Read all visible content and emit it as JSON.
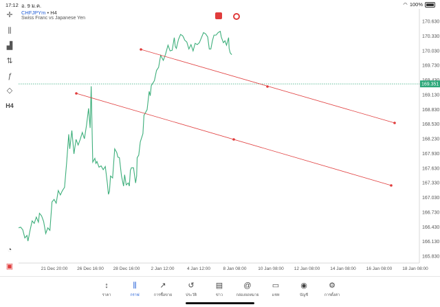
{
  "status": {
    "time": "17:12",
    "date": "อ. 9 ม.ค.",
    "battery": "100%"
  },
  "symbol": {
    "name": "CHFJPYm",
    "sep": "•",
    "timeframe": "H4",
    "description": "Swiss Franc vs Japanese Yen"
  },
  "left_tools": {
    "timeframe_label": "H4"
  },
  "chart": {
    "price_labels": [
      "170.630",
      "170.330",
      "170.030",
      "169.730",
      "169.430",
      "169.130",
      "168.830",
      "168.530",
      "168.230",
      "167.930",
      "167.630",
      "167.330",
      "167.030",
      "166.730",
      "166.430",
      "166.130",
      "165.830"
    ],
    "current_price": "169.351",
    "time_labels": [
      "21 Dec 20:00",
      "26 Dec 16:00",
      "28 Dec 16:00",
      "2 Jan 12:00",
      "4 Jan 12:00",
      "8 Jan 08:00",
      "10 Jan 08:00",
      "12 Jan 08:00",
      "14 Jan 08:00",
      "16 Jan 08:00",
      "18 Jan 08:00"
    ]
  },
  "colors": {
    "line": "#3cae7a",
    "trend": "#e03c3c",
    "price_line": "#2ea87a",
    "accent": "#1e5bd6"
  },
  "tabs": [
    {
      "label": "ราคา",
      "icon": "↕"
    },
    {
      "label": "กราฟ",
      "icon": "⫼"
    },
    {
      "label": "การซื้อขาย",
      "icon": "↗"
    },
    {
      "label": "ประวัติ",
      "icon": "↺"
    },
    {
      "label": "ข่าว",
      "icon": "▤"
    },
    {
      "label": "กล่องจดหมาย",
      "icon": "@"
    },
    {
      "label": "แชท",
      "icon": "▭"
    },
    {
      "label": "บัญชี",
      "icon": "◉"
    },
    {
      "label": "การตั้งค่า",
      "icon": "⚙"
    }
  ]
}
